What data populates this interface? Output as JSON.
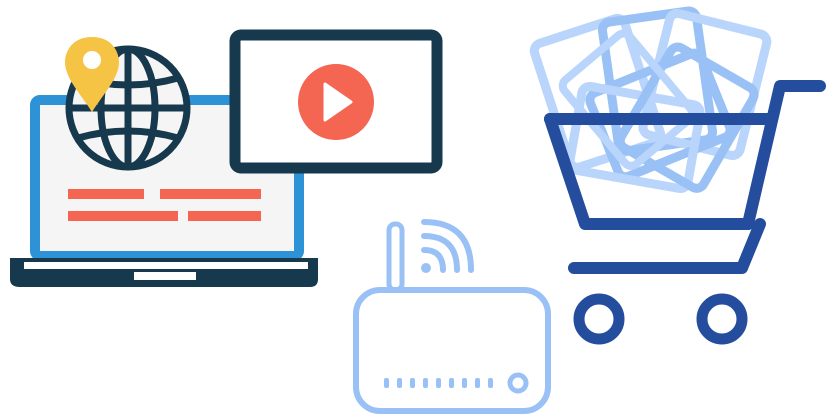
{
  "illustration": {
    "elements": [
      {
        "icon": "laptop-icon"
      },
      {
        "icon": "globe-icon"
      },
      {
        "icon": "location-pin-icon"
      },
      {
        "icon": "video-player-icon"
      },
      {
        "icon": "play-icon"
      },
      {
        "icon": "wifi-router-icon"
      },
      {
        "icon": "wifi-signal-icon"
      },
      {
        "icon": "shopping-cart-icon"
      },
      {
        "icon": "tablet-devices-icon"
      }
    ],
    "colors": {
      "navy": "#17394d",
      "blue": "#2e92d6",
      "coral": "#f46552",
      "yellow": "#f6c445",
      "cart_blue": "#244e9d",
      "light_blue": "#9ac1f5",
      "pale_blue": "#b9d5fb",
      "screen_bg": "#f5f5f5"
    }
  }
}
